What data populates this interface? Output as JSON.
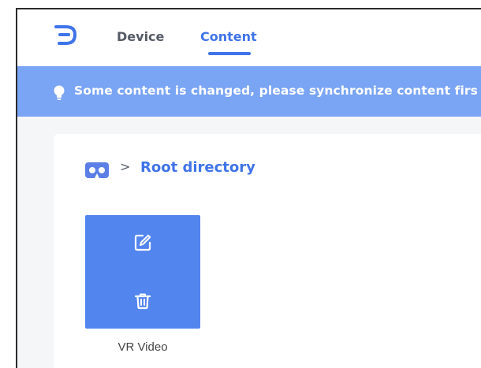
{
  "nav": {
    "tabs": [
      {
        "label": "Device",
        "active": false
      },
      {
        "label": "Content",
        "active": true
      }
    ]
  },
  "banner": {
    "message": "Some content is changed, please synchronize content firs"
  },
  "breadcrumb": {
    "separator": ">",
    "current": "Root directory"
  },
  "items": [
    {
      "label": "VR Video"
    }
  ],
  "icons": {
    "logo": "app-logo-icon",
    "banner": "lightbulb-icon",
    "root": "vr-headset-icon",
    "edit": "edit-icon",
    "delete": "trash-icon"
  },
  "colors": {
    "accent": "#3f73e8",
    "banner": "#7aa4f4",
    "card": "#5385ef"
  }
}
